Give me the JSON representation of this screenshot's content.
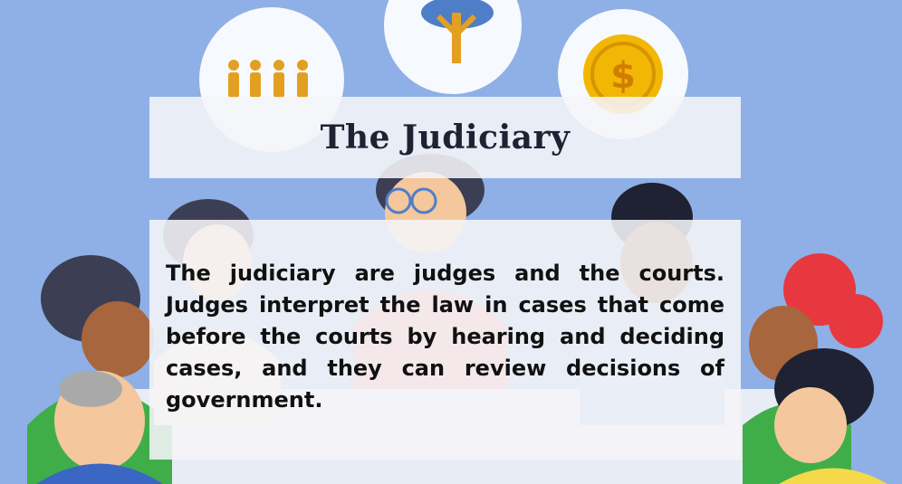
{
  "slide": {
    "title": "The Judiciary",
    "body": "The judiciary are judges and the courts. Judges interpret the law in cases that come before the courts by hearing and deciding cases, and they can review decisions of government.",
    "background_color": "#8fb0e6",
    "panel_color": "#f5f5f8",
    "icons": [
      "people-icon",
      "tree-icon",
      "dollar-coin-icon"
    ]
  }
}
